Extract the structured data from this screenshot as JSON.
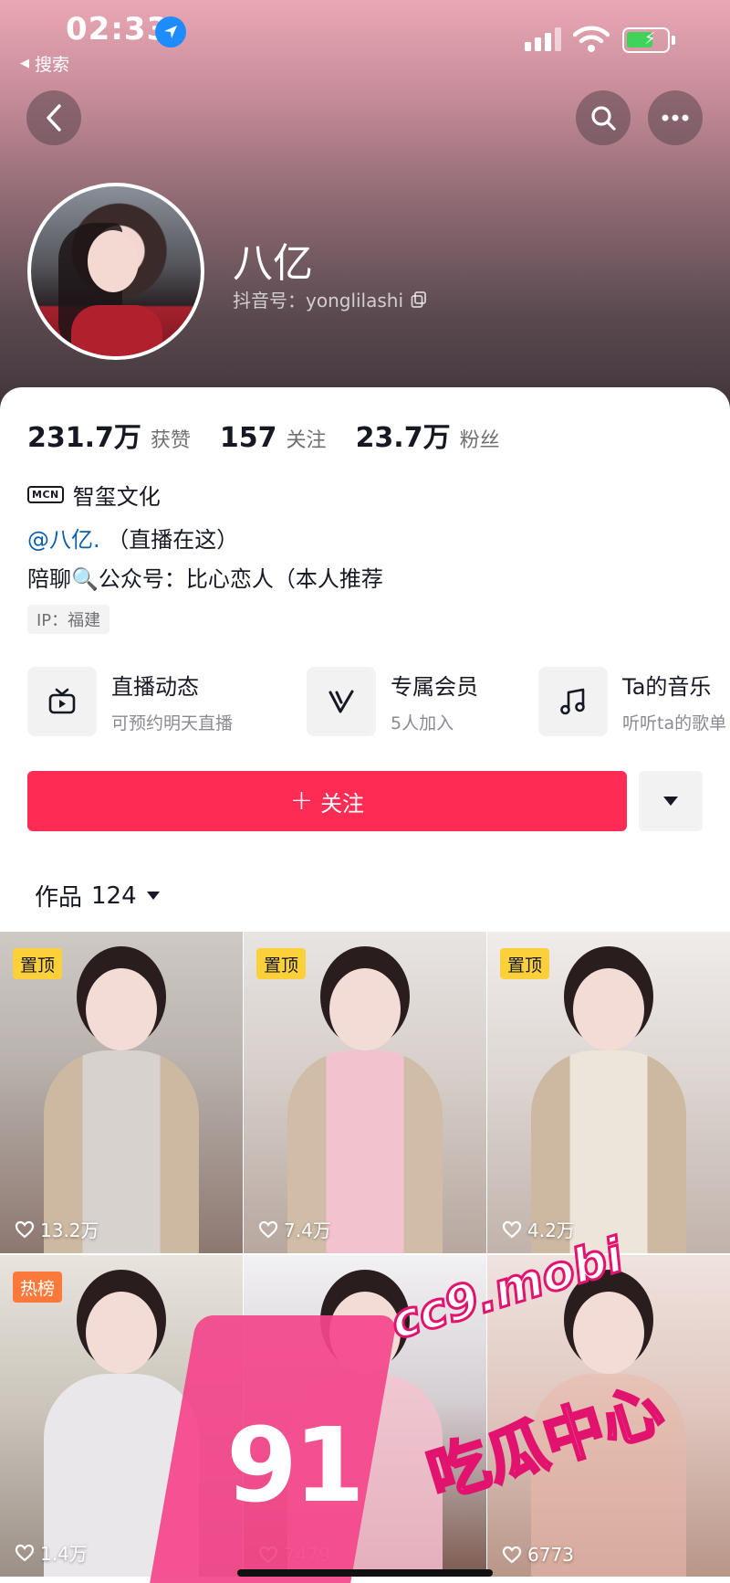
{
  "status_bar": {
    "time": "02:33",
    "back_app": "搜索"
  },
  "profile": {
    "nickname": "八亿",
    "douyin_id": "抖音号：yonglilashi",
    "stats": [
      {
        "value": "231.7万",
        "label": "获赞"
      },
      {
        "value": "157",
        "label": "关注"
      },
      {
        "value": "23.7万",
        "label": "粉丝"
      }
    ],
    "mcn_badge": "MCN",
    "mcn_name": "智玺文化",
    "bio_mention": "@八亿.",
    "bio_line1_rest": "（直播在这）",
    "bio_line2": "陪聊🔍公众号：比心恋人（本人推荐",
    "ip": "IP：福建"
  },
  "features": [
    {
      "title": "直播动态",
      "subtitle": "可预约明天直播",
      "icon": "tv-icon"
    },
    {
      "title": "专属会员",
      "subtitle": "5人加入",
      "icon": "vip-v-icon"
    },
    {
      "title": "Ta的音乐",
      "subtitle": "听听ta的歌单",
      "icon": "music-note-icon"
    }
  ],
  "follow_button": "关注",
  "works_tab": {
    "label": "作品",
    "count": "124"
  },
  "videos": [
    {
      "badge": "置顶",
      "likes": "13.2万"
    },
    {
      "badge": "置顶",
      "likes": "7.4万"
    },
    {
      "badge": "置顶",
      "likes": "4.2万"
    },
    {
      "badge": "热榜",
      "likes": "1.4万"
    },
    {
      "badge": "",
      "likes": "7479"
    },
    {
      "badge": "",
      "likes": "6773"
    }
  ],
  "watermark": {
    "logo_number": "91",
    "url": "cc9.mobi",
    "title": "吃瓜中心"
  },
  "colors": {
    "follow_red": "#fe2c55",
    "pin_badge": "#fcd03a",
    "hot_badge": "#fb7a3b",
    "mention_blue": "#0b5fa8"
  }
}
